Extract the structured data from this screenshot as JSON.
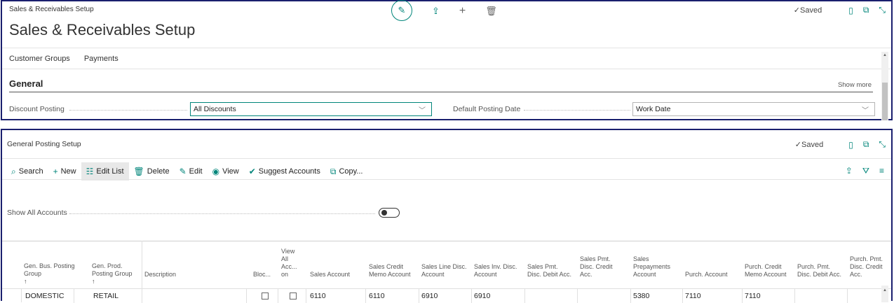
{
  "setup_page": {
    "breadcrumb": "Sales & Receivables Setup",
    "title": "Sales & Receivables Setup",
    "status": "Saved",
    "tabs": [
      "Customer Groups",
      "Payments"
    ],
    "section": {
      "title": "General",
      "show_more": "Show more",
      "fields": [
        {
          "label": "Discount Posting",
          "value": "All Discounts"
        },
        {
          "label": "Default Posting Date",
          "value": "Work Date"
        }
      ]
    }
  },
  "list_page": {
    "title": "General Posting Setup",
    "status": "Saved",
    "actions": [
      {
        "label": "Search",
        "icon": "search-icon"
      },
      {
        "label": "New",
        "icon": "plus-icon"
      },
      {
        "label": "Edit List",
        "icon": "edit-list-icon"
      },
      {
        "label": "Delete",
        "icon": "trash-icon"
      },
      {
        "label": "Edit",
        "icon": "pencil-icon"
      },
      {
        "label": "View",
        "icon": "eye-icon"
      },
      {
        "label": "Suggest Accounts",
        "icon": "check-circle-icon"
      },
      {
        "label": "Copy...",
        "icon": "copy-icon"
      }
    ],
    "toggle_label": "Show All Accounts",
    "toggle_on": false,
    "columns": [
      "Gen. Bus. Posting Group",
      "Gen. Prod. Posting Group",
      "Description",
      "Bloc...",
      "View All Acc... on",
      "Sales Account",
      "Sales Credit Memo Account",
      "Sales Line Disc. Account",
      "Sales Inv. Disc. Account",
      "Sales Pmt. Disc. Debit Acc.",
      "Sales Pmt. Disc. Credit Acc.",
      "Sales Prepayments Account",
      "Purch. Account",
      "Purch. Credit Memo Account",
      "Purch. Pmt. Disc. Debit Acc.",
      "Purch. Pmt. Disc. Credit Acc."
    ],
    "rows": [
      {
        "bus_group": "DOMESTIC",
        "prod_group": "RETAIL",
        "description": "",
        "blocked": false,
        "view_all": false,
        "sales_account": "6110",
        "sales_credit_memo": "6110",
        "sales_line_disc": "6910",
        "sales_inv_disc": "6910",
        "sales_pmt_debit": "",
        "sales_pmt_credit": "",
        "sales_prepayments": "5380",
        "purch_account": "7110",
        "purch_credit_memo": "7110",
        "purch_pmt_debit": "",
        "purch_pmt_credit": ""
      }
    ]
  },
  "colors": {
    "accent": "#00857a",
    "panel_border": "#1a1f6e"
  }
}
